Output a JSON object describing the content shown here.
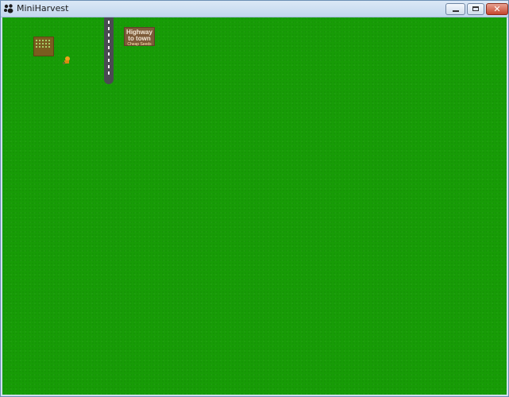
{
  "window": {
    "title": "MiniHarvest",
    "close_glyph": "✕"
  },
  "icons": {
    "app": "paw-icon",
    "minimize": "minimize-icon",
    "maximize": "maximize-icon",
    "close": "close-icon"
  },
  "colors": {
    "grass": "#179c06",
    "road": "#4a4a52",
    "sign": "#7d5a38",
    "soil": "#7a5d1f",
    "close_button": "#c5452c"
  },
  "game": {
    "sign": {
      "line1": "Highway",
      "line2": "to town",
      "line3": "Cheap Seeds"
    }
  }
}
